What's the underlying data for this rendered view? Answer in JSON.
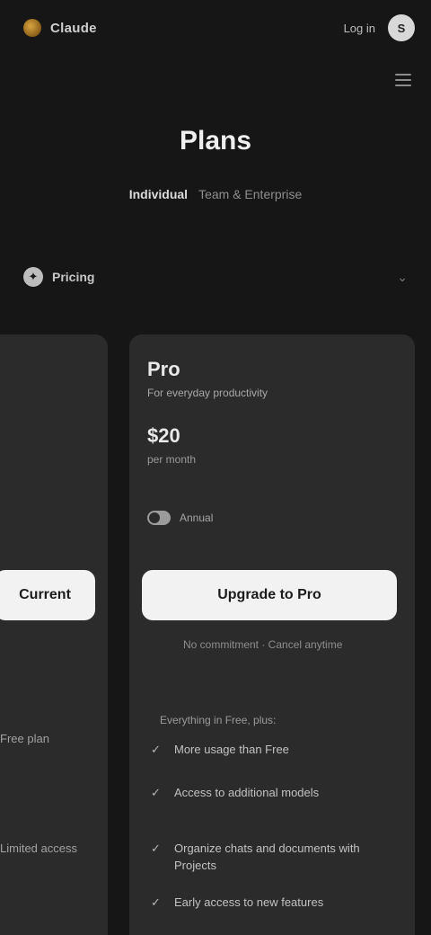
{
  "topbar": {
    "brand_name": "Claude",
    "link_label": "Log in",
    "avatar_initial": "S"
  },
  "hero": {
    "title": "Plans",
    "sub_strong": "Individual",
    "sub_muted": "Team & Enterprise"
  },
  "filter": {
    "label": "Pricing"
  },
  "left_plan": {
    "cta_label": "Current",
    "note_1": "Free plan",
    "note_2": "Limited access"
  },
  "plan": {
    "name": "Pro",
    "tagline": "For everyday productivity",
    "price": "$20",
    "period": "per month",
    "toggle_label": "Annual",
    "cta_label": "Upgrade to Pro",
    "cta_note": "No commitment · Cancel anytime",
    "features_heading": "Everything in Free, plus:",
    "features": [
      "More usage than Free",
      "Access to additional models",
      "Organize chats and documents with Projects",
      "Early access to new features"
    ]
  }
}
